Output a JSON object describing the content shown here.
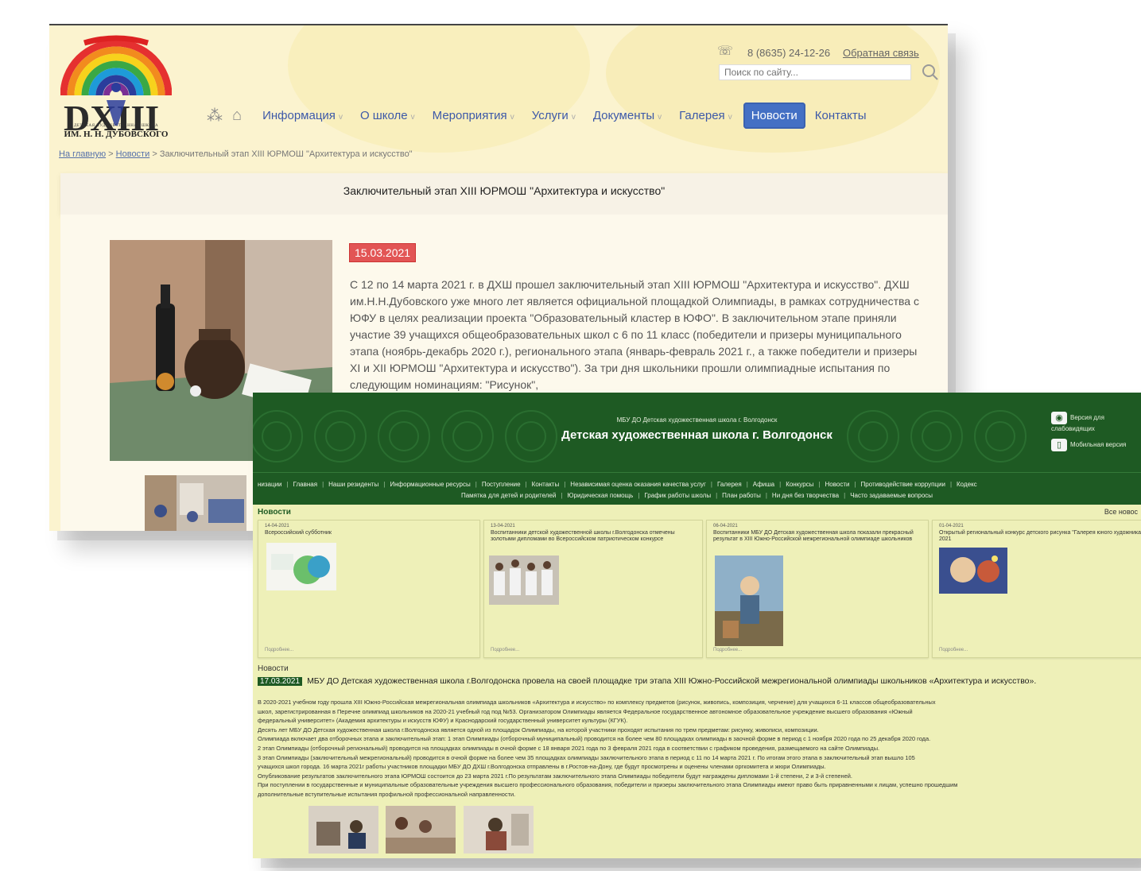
{
  "site1": {
    "logo_caption_small": "ДЕТСКАЯ ХУДОЖЕСТВЕННАЯ ШКОЛА",
    "logo_caption_name": "ИМ. Н. Н. ДУБОВСКОГО",
    "logo_letters": "DXIII",
    "phone": "8 (8635) 24-12-26",
    "feedback_link": "Обратная связь",
    "search_placeholder": "Поиск по сайту...",
    "nav": {
      "items": [
        {
          "label": "Информация",
          "chevron": "v"
        },
        {
          "label": "О школе",
          "chevron": "v"
        },
        {
          "label": "Мероприятия",
          "chevron": "v"
        },
        {
          "label": "Услуги",
          "chevron": "v"
        },
        {
          "label": "Документы",
          "chevron": "v"
        },
        {
          "label": "Галерея",
          "chevron": "v"
        }
      ],
      "active": "Новости",
      "last": "Контакты"
    },
    "breadcrumb": {
      "home": "На главную",
      "sep": ">",
      "section": "Новости",
      "current": "Заключительный этап XIII ЮРМОШ \"Архитектура и искусство\""
    },
    "title": "Заключительный этап XIII ЮРМОШ \"Архитектура и искусство\"",
    "date": "15.03.2021",
    "article_text": "С 12 по 14 марта 2021 г. в ДХШ прошел заключительный этап XIII ЮРМОШ \"Архитектура и искусство\". ДХШ им.Н.Н.Дубовского уже много лет является официальной площадкой Олимпиады, в рамках сотрудничества с ЮФУ в целях реализации проекта \"Образовательный кластер в ЮФО\". В заключительном этапе приняли участие 39 учащихся общеобразовательных школ с 6 по 11 класс (победители и призеры муниципального этапа (ноябрь-декабрь 2020 г.), регионального этапа (январь-февраль 2021 г., а также победители и призеры XI и XII ЮРМОШ \"Архитектура и искусство\"). За три дня школьники прошли олимпиадные испытания по следующим номинациям: \"Рисунок\","
  },
  "site2": {
    "subtitle": "МБУ ДО Детская художественная школа г. Волгодонск",
    "title": "Детская художественная школа г. Волгодонск",
    "side": {
      "visually_impaired": "Версия для слабовидящих",
      "mobile": "Мобильная версия"
    },
    "menu_row1": [
      "низации",
      "Главная",
      "Наши резиденты",
      "Информационные ресурсы",
      "Поступление",
      "Контакты",
      "Независимая оценка оказания качества услуг",
      "Галерея",
      "Афиша",
      "Конкурсы",
      "Новости",
      "Противодействие коррупции",
      "Кодекс"
    ],
    "menu_row2": [
      "Памятка для детей и родителей",
      "Юридическая помощь",
      "График работы школы",
      "План работы",
      "Ни дня без творчества",
      "Часто задаваемые вопросы"
    ],
    "news_heading": "Новости",
    "all_news": "Все новос",
    "cards": [
      {
        "date": "14-04-2021",
        "title": "Всероссийский субботник",
        "more": "Подробнее..."
      },
      {
        "date": "13-04-2021",
        "title": "Воспитанники детской художественной школы г.Волгодонска отмечены золотыми дипломами во Всероссийском патриотическом конкурсе",
        "more": "Подробнее..."
      },
      {
        "date": "06-04-2021",
        "title": "Воспитанники МБУ ДО Детская художественная школа показали прекрасный результат в XIII Южно-Российской межрегиональной олимпиаде школьников",
        "more": "Подробнее..."
      },
      {
        "date": "01-04-2021",
        "title": "Открытый региональный конкурс детского рисунка \"Галерея юного художника\" 2021",
        "more": "Подробнее..."
      }
    ],
    "news2_heading": "Новости",
    "headline_date": "17.03.2021",
    "headline": "МБУ ДО Детская художественная школа г.Волгодонска провела на своей площадке три этапа XIII Южно-Российской межрегиональной олимпиады школьников «Архитектура и искусство».",
    "paragraphs": [
      "В 2020-2021 учебном году прошла XIII Южно-Российская межрегиональная олимпиада школьников «Архитектура и искусство» по комплексу предметов (рисунок, живопись, композиция, черчение) для учащихся 6-11 классов общеобразовательных",
      "школ, зарегистрированная в Перечне олимпиад школьников на 2020-21 учебный год под №53. Организатором Олимпиады является Федеральное государственное автономное образовательное учреждение высшего образования «Южный",
      "федеральный университет» (Академия архитектуры и искусств ЮФУ) и Краснодарский государственный университет культуры (КГУК).",
      "Десять лет МБУ ДО Детская художественная школа г.Волгодонска является одной из площадок Олимпиады, на которой участники проходят испытания по трем предметам: рисунку, живописи, композиции.",
      "Олимпиада включает два отборочных этапа и заключительный этап: 1 этап Олимпиады (отборочный муниципальный) проводится на более чем 80 площадках олимпиады в заочной форме в период с 1 ноября 2020 года по 25 декабря 2020 года.",
      "2 этап Олимпиады (отборочный региональный) проводится на площадках олимпиады в очной форме с 18 января 2021 года по 3 февраля 2021 года в соответствии с графиком проведения, размещаемого на сайте Олимпиады.",
      "3 этап Олимпиады (заключительный межрегиональный) проводится в очной форме на более чем 35 площадках олимпиады заключительного этапа в период с 11 по 14 марта 2021 г. По итогам этого этапа в заключительный этап вышло 105",
      "учащихся школ города. 16 марта 2021г работы участников площадки МБУ ДО ДХШ г.Волгодонска отправлены в г.Ростов-на-Дону, где будут просмотрены и оценены членами оргкомитета и жюри Олимпиады.",
      "Опубликование результатов заключительного этапа ЮРМОШ состоится до 23 марта 2021 г.По результатам заключительного этапа Олимпиады победители будут награждены дипломами 1-й степени, 2 и 3-й степеней.",
      "При поступлении в государственные и муниципальные образовательные учреждения высшего профессионального образования, победители и призеры заключительного этапа Олимпиады имеют право быть приравненными к лицам, успешно прошедшим",
      "дополнительные вступительные испытания профильной профессиональной направленности."
    ]
  },
  "colors": {
    "site1_nav_text": "#3d59a8",
    "site1_active": "#4470c4",
    "site1_date_badge": "#e25555",
    "site2_green": "#1e5a23",
    "site2_bg": "#eef0b8"
  }
}
